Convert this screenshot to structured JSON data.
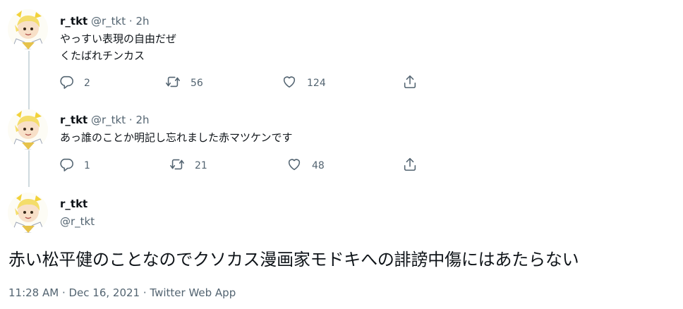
{
  "tweets": [
    {
      "name": "r_tkt",
      "handle": "@r_tkt",
      "separator": "·",
      "time": "2h",
      "lines": [
        "やっすい表現の自由だぜ",
        "くたばれチンカス"
      ],
      "replies": "2",
      "retweets": "56",
      "likes": "124"
    },
    {
      "name": "r_tkt",
      "handle": "@r_tkt",
      "separator": "·",
      "time": "2h",
      "lines": [
        "あっ誰のことか明記し忘れました赤マツケンです"
      ],
      "replies": "1",
      "retweets": "21",
      "likes": "48"
    }
  ],
  "main_tweet": {
    "name": "r_tkt",
    "handle": "@r_tkt",
    "text": "赤い松平健のことなのでクソカス漫画家モドキへの誹謗中傷にはあたらない",
    "timestamp": "11:28 AM · Dec 16, 2021 · Twitter Web App"
  },
  "icons": {
    "reply": "reply-icon",
    "retweet": "retweet-icon",
    "like": "heart-icon",
    "share": "share-icon"
  },
  "colors": {
    "text_primary": "#0f1419",
    "text_secondary": "#536471",
    "thread_line": "#cfd9de"
  }
}
